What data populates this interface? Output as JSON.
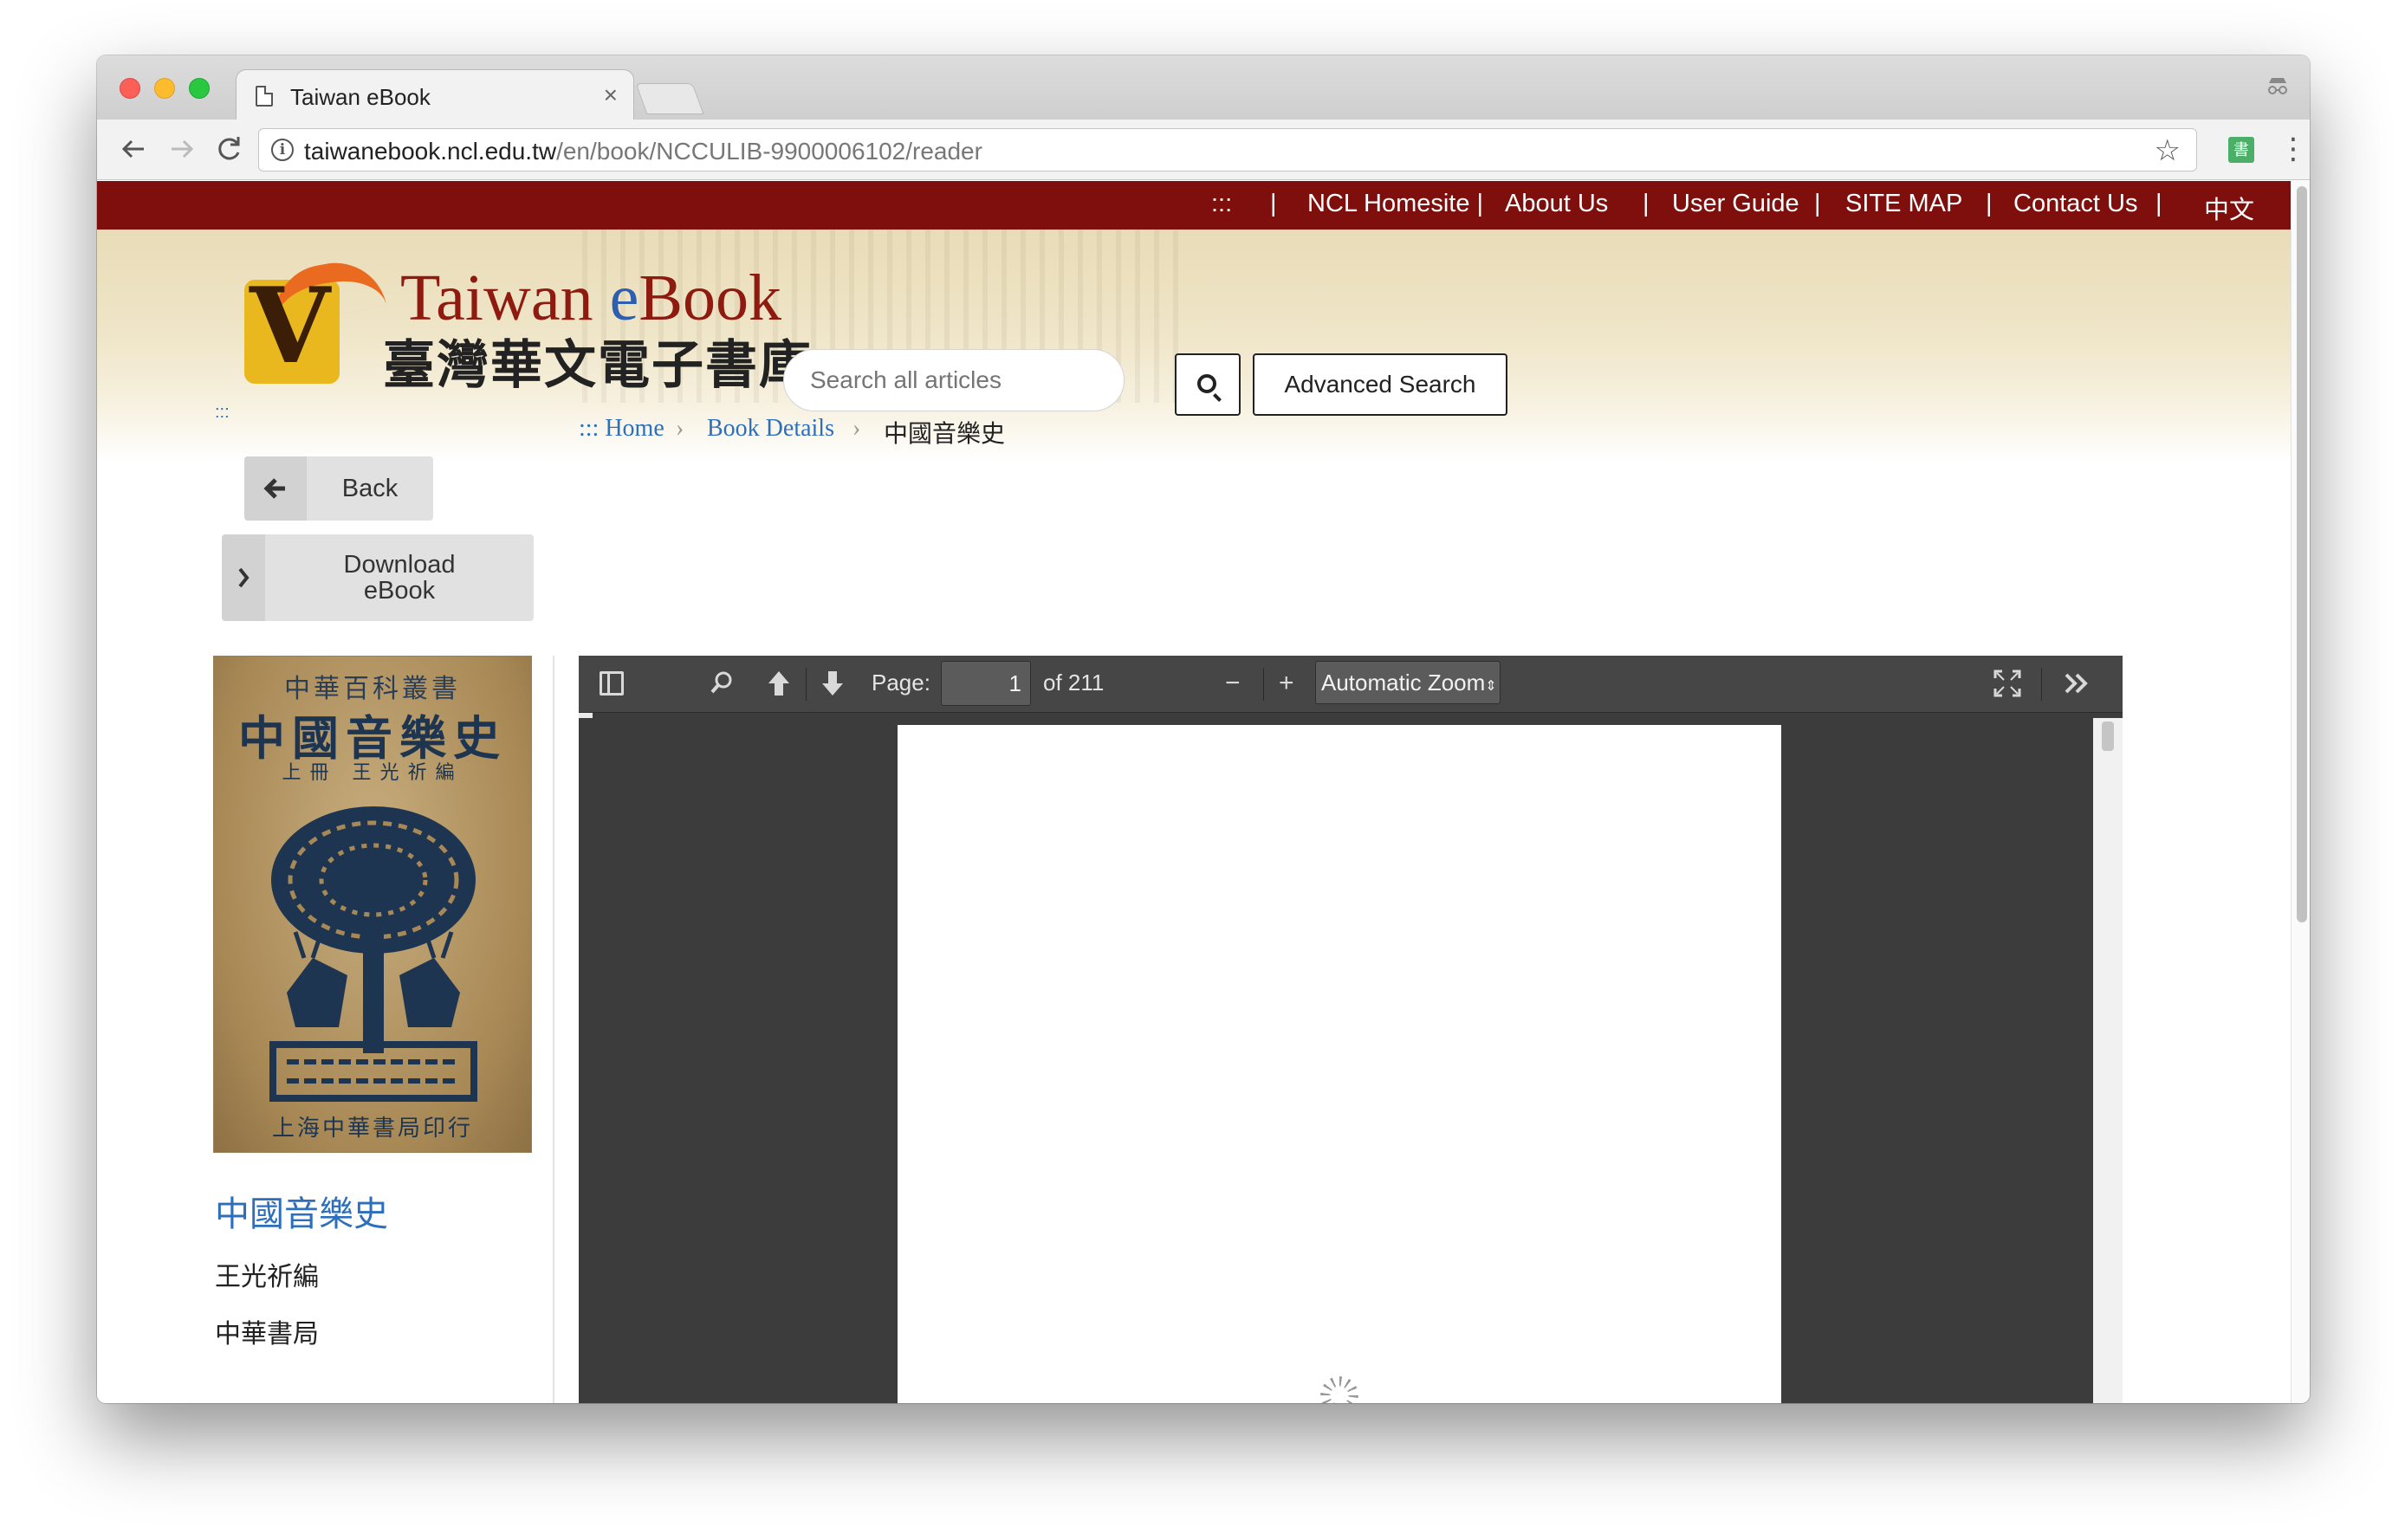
{
  "browser": {
    "tab_title": "Taiwan eBook",
    "tab_close": "×",
    "url_host": "taiwanebook.ncl.edu.tw",
    "url_path": "/en/book/NCCULIB-9900006102/reader",
    "extension_label": "書"
  },
  "topnav": {
    "menu_dots": ":::",
    "sep": "|",
    "items": [
      "NCL Homesite |",
      "About Us",
      "User Guide",
      "SITE MAP",
      "Contact Us",
      "中文"
    ]
  },
  "header": {
    "logo_en_a": "Taiwan ",
    "logo_en_b": "e",
    "logo_en_c": "Book",
    "logo_zh": "臺灣華文電子書庫",
    "search_placeholder": "Search all articles",
    "advanced_search": "Advanced Search"
  },
  "sidebar": {
    "menu_dots": ":::",
    "back_label": "Back",
    "download_line1": "Download",
    "download_line2": "eBook",
    "cover": {
      "series": "中華百科叢書",
      "title": "中國音樂史",
      "volume": "上冊",
      "editor": "王光祈編",
      "publisher": "上海中華書局印行"
    },
    "book_title": "中國音樂史",
    "author": "王光祈編",
    "publisher": "中華書局"
  },
  "breadcrumb": {
    "home": "::: Home",
    "details": "Book Details",
    "current": "中國音樂史",
    "sep": "›"
  },
  "pdf_viewer": {
    "page_label": "Page:",
    "page_value": "1",
    "page_total": "of 211",
    "zoom_value": "Automatic Zoom",
    "zoom_out": "−",
    "zoom_in": "+"
  },
  "colors": {
    "topnav_bg": "#7e0f0c",
    "link_blue": "#2d6fba",
    "pdf_toolbar": "#464646"
  }
}
